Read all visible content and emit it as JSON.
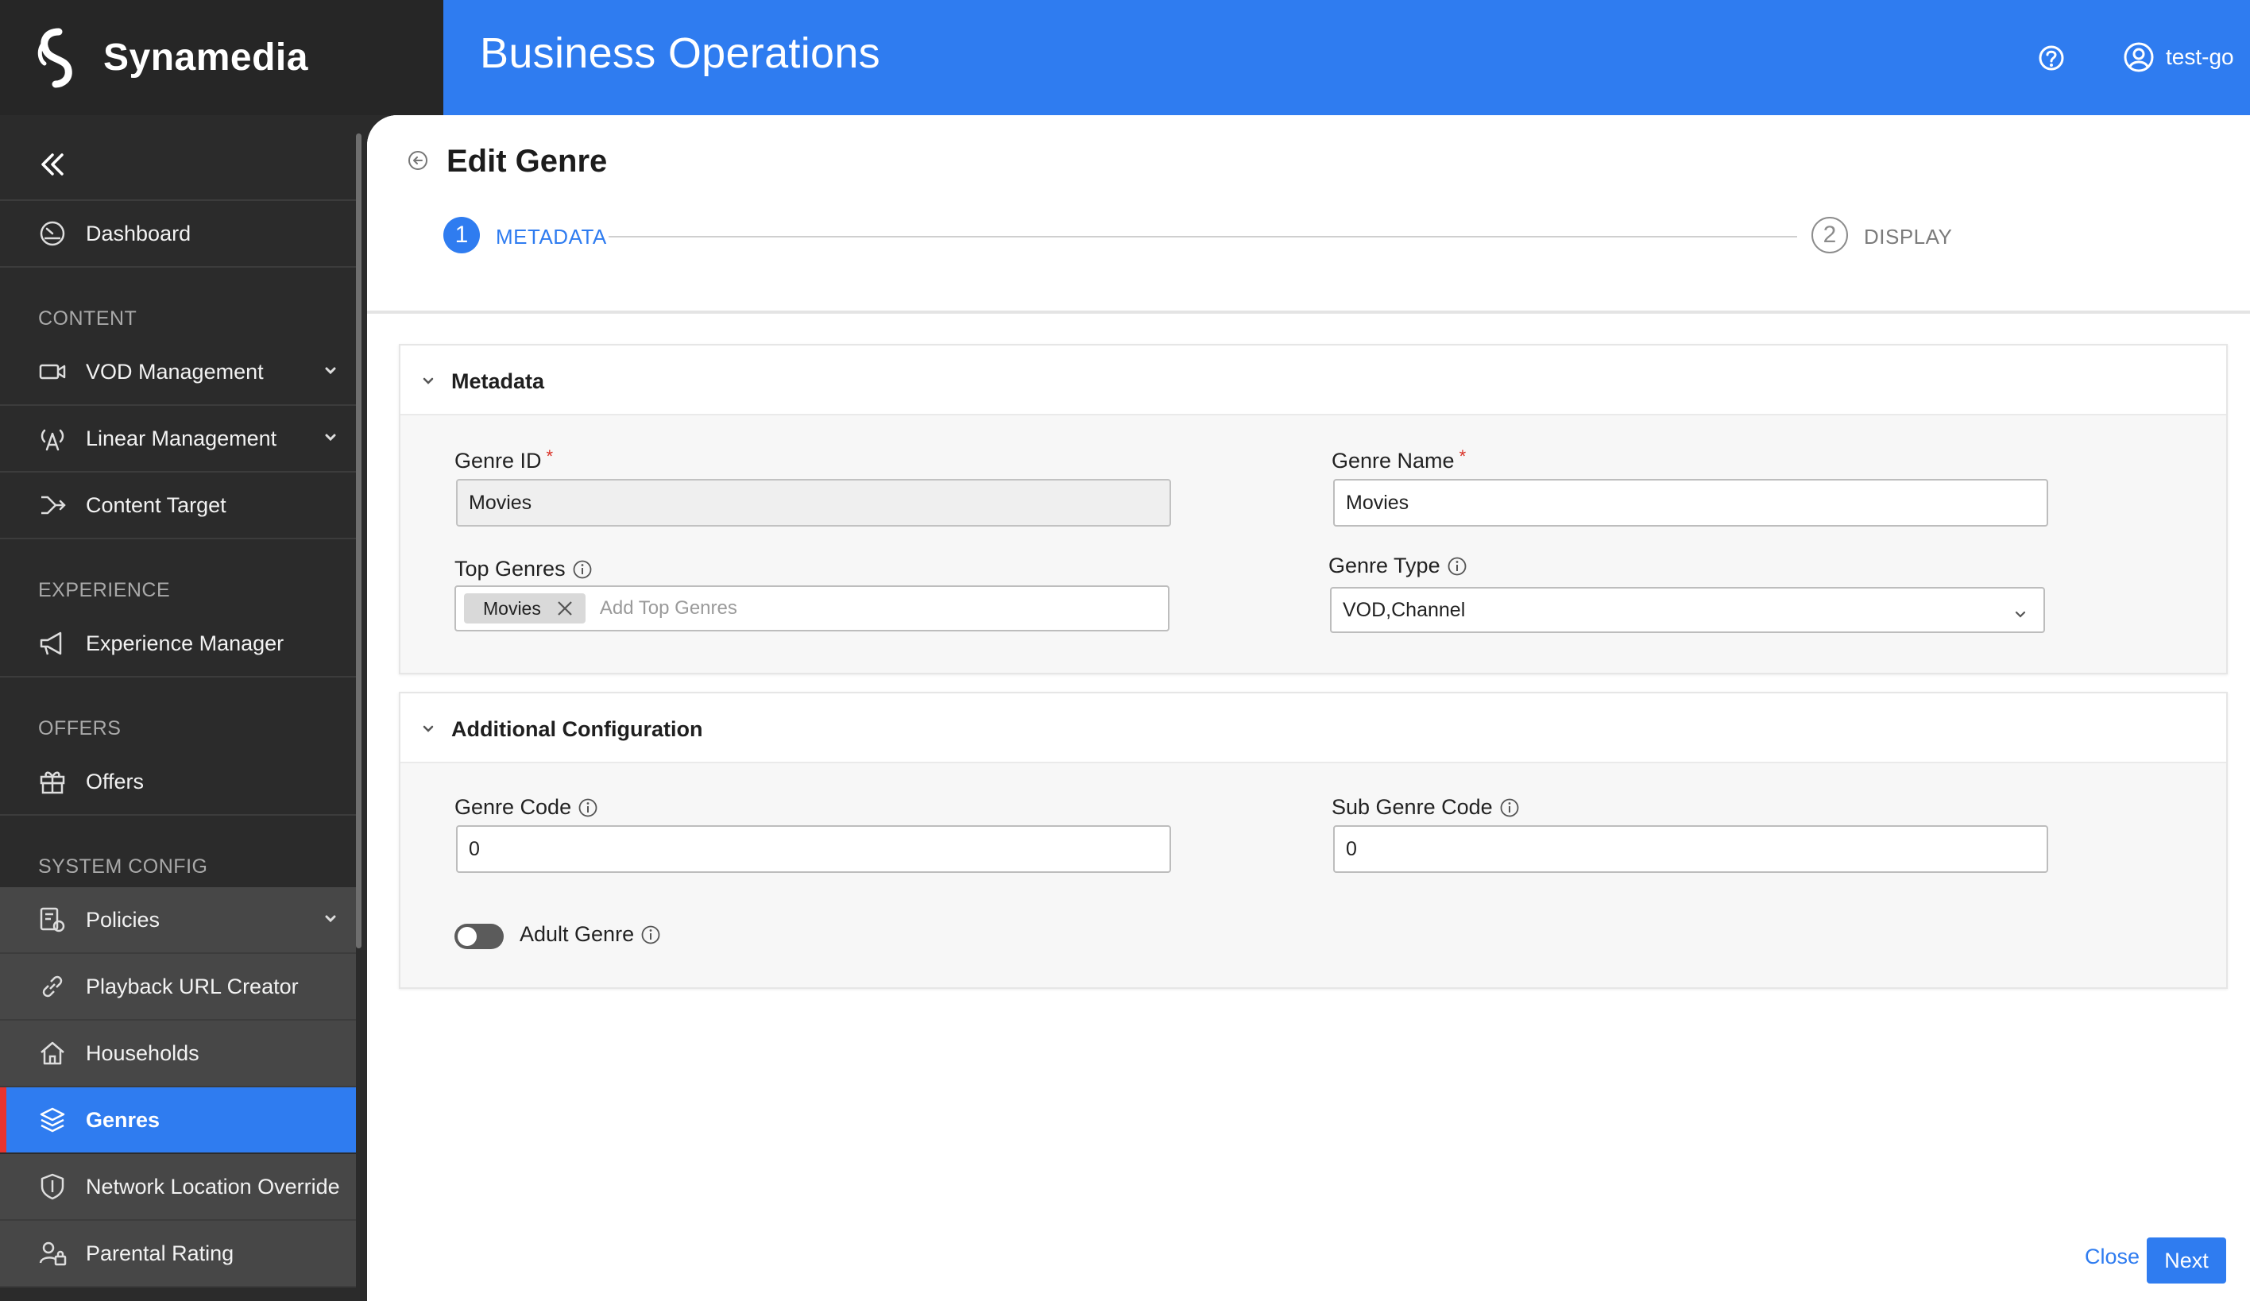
{
  "brand": {
    "name": "Synamedia"
  },
  "header": {
    "title": "Business Operations",
    "user": "test-go"
  },
  "sidebar": {
    "items": [
      {
        "label": "Dashboard"
      },
      {
        "label": "VOD Management"
      },
      {
        "label": "Linear Management"
      },
      {
        "label": "Content Target"
      },
      {
        "label": "Experience Manager"
      },
      {
        "label": "Offers"
      },
      {
        "label": "Policies"
      },
      {
        "label": "Playback URL Creator"
      },
      {
        "label": "Households"
      },
      {
        "label": "Genres"
      },
      {
        "label": "Network Location Override"
      },
      {
        "label": "Parental Rating"
      }
    ],
    "sections": [
      "CONTENT",
      "EXPERIENCE",
      "OFFERS",
      "SYSTEM CONFIG"
    ]
  },
  "page": {
    "title": "Edit Genre",
    "steps": [
      {
        "number": "1",
        "label": "METADATA"
      },
      {
        "number": "2",
        "label": "DISPLAY"
      }
    ]
  },
  "metadata": {
    "title": "Metadata",
    "genre_id_label": "Genre ID",
    "genre_id_value": "Movies",
    "genre_name_label": "Genre Name",
    "genre_name_value": "Movies",
    "top_genres_label": "Top Genres",
    "top_genres_chip": "Movies",
    "top_genres_placeholder": "Add Top Genres",
    "genre_type_label": "Genre Type",
    "genre_type_value": "VOD,Channel",
    "required_mark": "*"
  },
  "additional": {
    "title": "Additional Configuration",
    "genre_code_label": "Genre Code",
    "genre_code_value": "0",
    "sub_genre_code_label": "Sub Genre Code",
    "sub_genre_code_value": "0",
    "adult_genre_label": "Adult Genre",
    "adult_genre_on": false
  },
  "actions": {
    "close": "Close",
    "next": "Next"
  },
  "colors": {
    "accent": "#2f7cf0",
    "sidebar_bg": "#2b2b2b",
    "active_marker": "#e8342f"
  }
}
